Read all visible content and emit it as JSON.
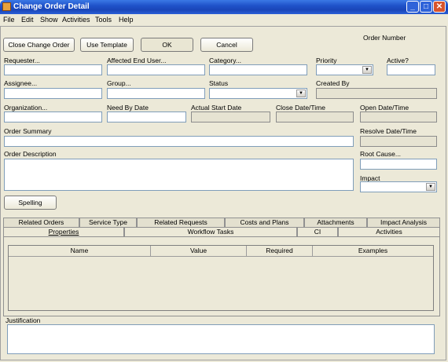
{
  "window": {
    "title": "Change Order Detail"
  },
  "menu": [
    "File",
    "Edit",
    "Show",
    "Activities",
    "Tools",
    "Help"
  ],
  "toolbar": {
    "close_label": "Close Change Order",
    "template_label": "Use Template",
    "ok_label": "OK",
    "cancel_label": "Cancel"
  },
  "header": {
    "order_number_label": "Order Number"
  },
  "fields": {
    "requester": "Requester...",
    "affected_end_user": "Affected End User...",
    "category": "Category...",
    "priority": "Priority",
    "active": "Active?",
    "assignee": "Assignee...",
    "group": "Group...",
    "status": "Status",
    "created_by": "Created By",
    "organization": "Organization...",
    "need_by_date": "Need By Date",
    "actual_start_date": "Actual Start Date",
    "close_date_time": "Close Date/Time",
    "open_date_time": "Open Date/Time",
    "order_summary": "Order Summary",
    "resolve_date_time": "Resolve Date/Time",
    "order_description": "Order Description",
    "root_cause": "Root Cause...",
    "impact": "Impact"
  },
  "spelling_label": "Spelling",
  "tabs_back": [
    "Related Orders",
    "Service Type",
    "Related Requests",
    "Costs and Plans",
    "Attachments",
    "Impact Analysis"
  ],
  "tabs_front": [
    "Properties",
    "Workflow Tasks",
    "CI",
    "Activities"
  ],
  "table": {
    "columns": [
      "Name",
      "Value",
      "Required",
      "Examples"
    ]
  },
  "justification_label": "Justification"
}
